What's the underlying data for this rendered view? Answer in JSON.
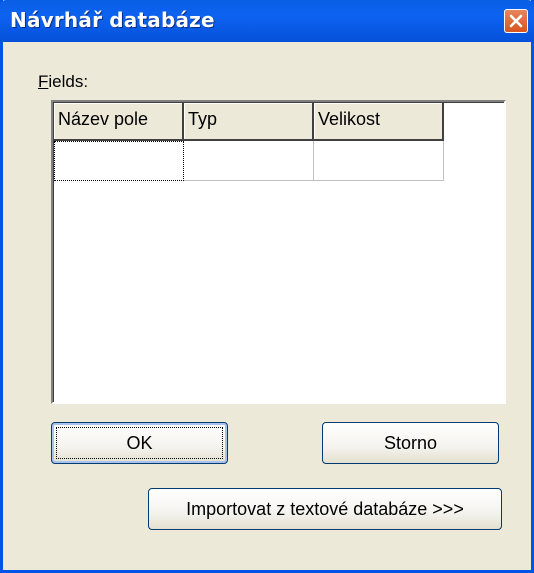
{
  "window": {
    "title": "Návrhář databáze",
    "close_icon": "close-icon",
    "accent_color": "#0055e5",
    "background_color": "#ece9d8"
  },
  "fields": {
    "label_mnemonic": "F",
    "label_rest": "ields:",
    "columns": [
      "Název pole",
      "Typ",
      "Velikost"
    ],
    "rows": [
      [
        "",
        "",
        ""
      ]
    ]
  },
  "buttons": {
    "ok": "OK",
    "cancel": "Storno",
    "import": "Importovat z textové databáze >>>"
  }
}
